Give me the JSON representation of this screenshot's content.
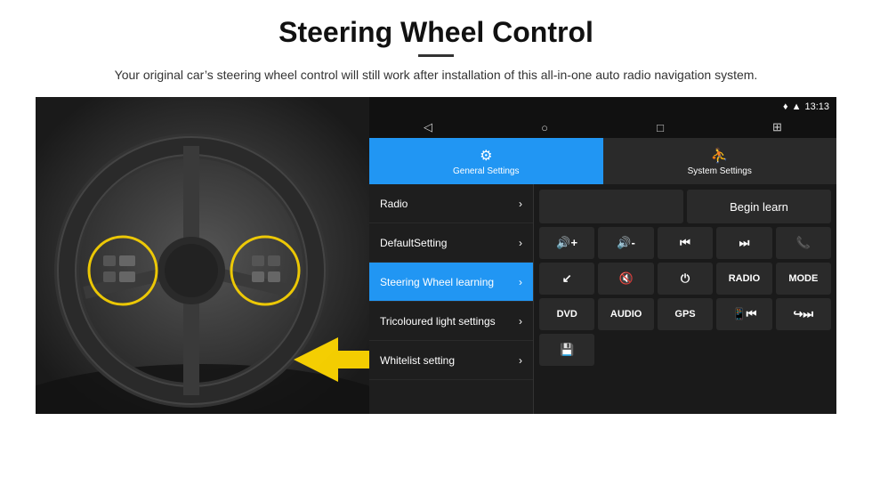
{
  "header": {
    "title": "Steering Wheel Control",
    "divider": true,
    "subtitle": "Your original car’s steering wheel control will still work after installation of this all-in-one auto radio navigation system."
  },
  "status_bar": {
    "location_icon": "•",
    "wifi_icon": "▲",
    "time": "13:13"
  },
  "nav_bar": {
    "back": "◁",
    "home": "○",
    "recent": "□",
    "grid": "☰"
  },
  "tabs": [
    {
      "label": "General Settings",
      "icon": "⚙",
      "active": true
    },
    {
      "label": "System Settings",
      "icon": "⛹",
      "active": false
    }
  ],
  "menu_items": [
    {
      "label": "Radio",
      "active": false
    },
    {
      "label": "DefaultSetting",
      "active": false
    },
    {
      "label": "Steering Wheel learning",
      "active": true
    },
    {
      "label": "Tricoloured light settings",
      "active": false
    },
    {
      "label": "Whitelist setting",
      "active": false
    }
  ],
  "control_panel": {
    "begin_learn_label": "Begin learn",
    "icon_rows": [
      [
        {
          "symbol": "🔊+",
          "label": "vol+"
        },
        {
          "symbol": "🔊-",
          "label": "vol-"
        },
        {
          "symbol": "⏮",
          "label": "prev"
        },
        {
          "symbol": "⏭",
          "label": "next"
        },
        {
          "symbol": "☎",
          "label": "phone"
        }
      ],
      [
        {
          "symbol": "⮐",
          "label": "pick"
        },
        {
          "symbol": "🔇×",
          "label": "mute"
        },
        {
          "symbol": "⏻",
          "label": "power"
        },
        {
          "symbol": "RADIO",
          "label": "radio"
        },
        {
          "symbol": "MODE",
          "label": "mode"
        }
      ],
      [
        {
          "symbol": "DVD",
          "label": "dvd"
        },
        {
          "symbol": "AUDIO",
          "label": "audio"
        },
        {
          "symbol": "GPS",
          "label": "gps"
        },
        {
          "symbol": "📱⏮",
          "label": "tel-prev"
        },
        {
          "symbol": "↪⏭",
          "label": "skip"
        }
      ],
      [
        {
          "symbol": "💾",
          "label": "media"
        }
      ]
    ]
  }
}
